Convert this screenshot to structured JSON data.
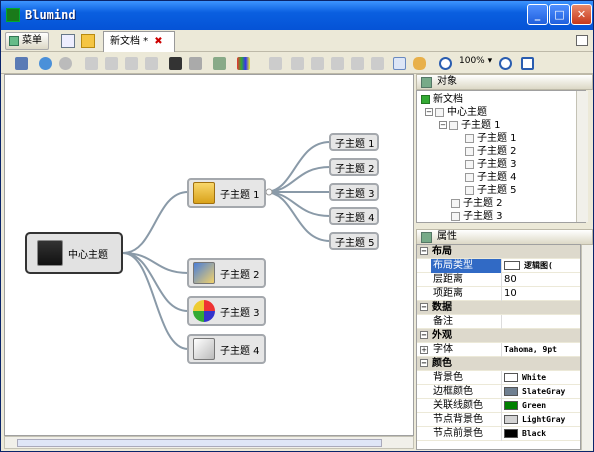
{
  "window": {
    "title": "Blumind"
  },
  "menu": {
    "label": "菜单"
  },
  "tab": {
    "label": "新文档 *",
    "close": "✖"
  },
  "toolbar": {
    "zoom": "100%"
  },
  "map": {
    "root": "中心主题",
    "topic1": "子主题 1",
    "topic2": "子主题 2",
    "topic3": "子主题 3",
    "topic4": "子主题 4",
    "sub": [
      "子主题 1",
      "子主题 2",
      "子主题 3",
      "子主题 4",
      "子主题 5"
    ]
  },
  "panel_objects": {
    "title": "对象",
    "tree": [
      {
        "label": "新文档"
      },
      {
        "label": "中心主题"
      },
      {
        "label": "子主题 1"
      },
      {
        "label": "子主题 1"
      },
      {
        "label": "子主题 2"
      },
      {
        "label": "子主题 3"
      },
      {
        "label": "子主题 4"
      },
      {
        "label": "子主题 5"
      },
      {
        "label": "子主题 2"
      },
      {
        "label": "子主题 3"
      }
    ]
  },
  "panel_props": {
    "title": "属性",
    "layout_cat": "布局",
    "layout_type": "布局类型",
    "layout_value": "逻辑图(",
    "layer_dist": "层距离",
    "layer_value": "80",
    "item_dist": "项距离",
    "item_value": "10",
    "data_cat": "数据",
    "note": "备注",
    "appearance_cat": "外观",
    "font": "字体",
    "font_value": "Tahoma, 9pt",
    "color_cat": "颜色",
    "bg_color": "背景色",
    "bg_value": "White",
    "border_color": "边框颜色",
    "border_value": "SlateGray",
    "link_color": "关联线颜色",
    "link_value": "Green",
    "node_bg": "节点背景色",
    "node_bg_value": "LightGray",
    "node_fg": "节点前景色",
    "node_fg_value": "Black"
  },
  "colors": {
    "white": "#ffffff",
    "slategray": "#708090",
    "green": "#008000",
    "lightgray": "#d3d3d3",
    "black": "#000000"
  }
}
